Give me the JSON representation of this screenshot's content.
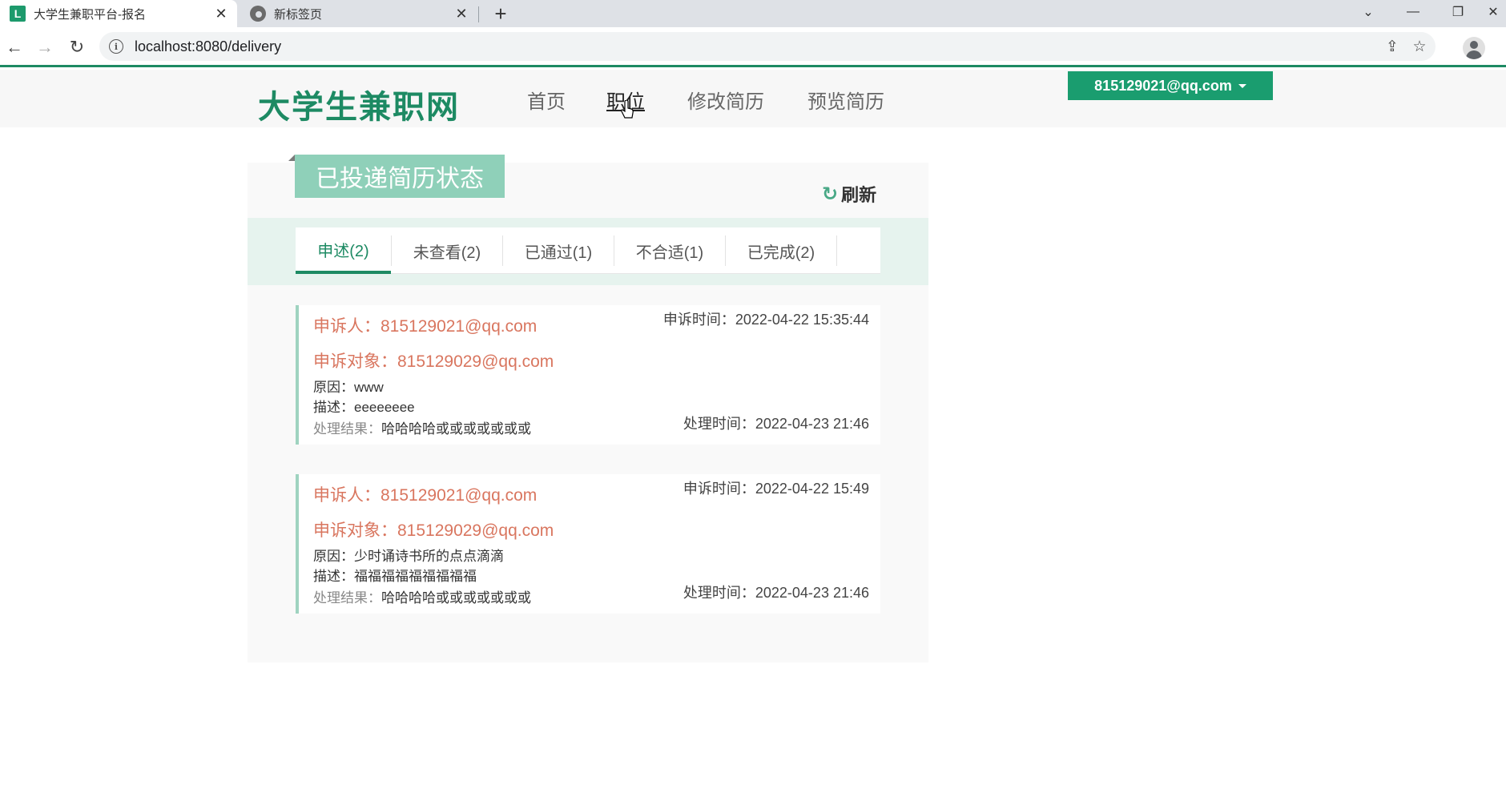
{
  "browser": {
    "tabs": [
      {
        "title": "大学生兼职平台-报名",
        "favicon": "L",
        "active": true
      },
      {
        "title": "新标签页",
        "active": false
      }
    ],
    "url": "localhost:8080/delivery"
  },
  "site": {
    "logo": "大学生兼职网",
    "nav": [
      "首页",
      "职位",
      "修改简历",
      "预览简历"
    ],
    "active_nav": "职位",
    "user_email": "815129021@qq.com",
    "accent_color": "#1d8a63"
  },
  "panel": {
    "title": "已投递简历状态",
    "refresh_label": "刷新",
    "tabs": [
      "申述(2)",
      "未查看(2)",
      "已通过(1)",
      "不合适(1)",
      "已完成(2)"
    ],
    "active_tab": "申述(2)"
  },
  "complaints": [
    {
      "reporter": "申诉人：815129021@qq.com",
      "appeal_time": "申诉时间：2022-04-22 15:35:44",
      "target": "申诉对象：815129029@qq.com",
      "reason": "原因：www",
      "description": "描述：eeeeeeee",
      "result_label": "处理结果：",
      "result": "哈哈哈哈或或或或或或或",
      "process_time": "处理时间：2022-04-23 21:46"
    },
    {
      "reporter": "申诉人：815129021@qq.com",
      "appeal_time": "申诉时间：2022-04-22 15:49",
      "target": "申诉对象：815129029@qq.com",
      "reason": "原因：少时诵诗书所的点点滴滴",
      "description": "描述：福福福福福福福福福",
      "result_label": "处理结果：",
      "result": "哈哈哈哈或或或或或或或",
      "process_time": "处理时间：2022-04-23 21:46"
    }
  ]
}
